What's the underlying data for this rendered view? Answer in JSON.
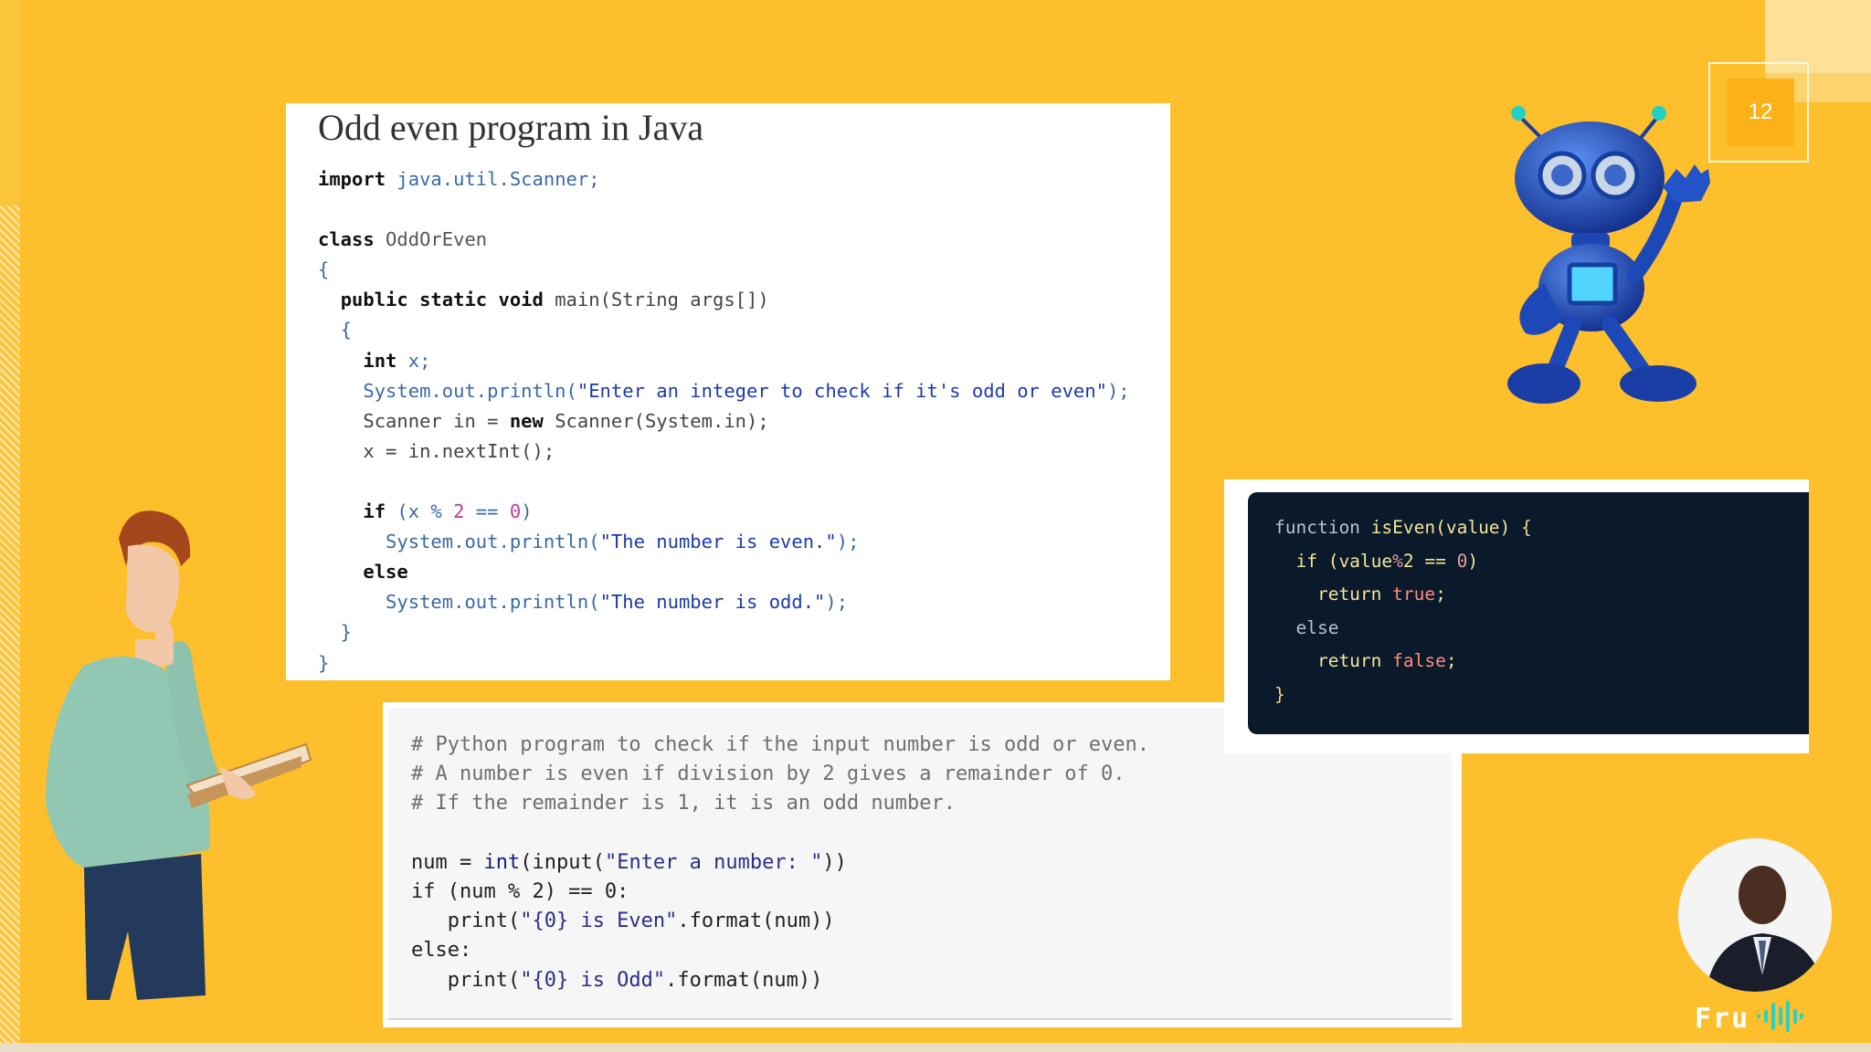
{
  "slide": {
    "page_number": "12"
  },
  "java": {
    "title": "Odd even program in Java",
    "lines": {
      "l1_kw": "import",
      "l1_rest": " java.util.Scanner;",
      "l3_kw": "class",
      "l3_rest": " OddOrEven",
      "l4": "{",
      "l5_indent": "  ",
      "l5_kw": "public static void",
      "l5_rest": " main(String args[])",
      "l6": "  {",
      "l7_indent": "    ",
      "l7_kw": "int",
      "l7_rest": " x;",
      "l8_pre": "    System.out.println(",
      "l8_str": "\"Enter an integer to check if it's odd or even\"",
      "l8_post": ");",
      "l9_pre": "    Scanner in = ",
      "l9_kw": "new",
      "l9_rest": " Scanner(System.in);",
      "l10": "    x = in.nextInt();",
      "l12_indent": "    ",
      "l12_kw": "if",
      "l12_a": " (x % ",
      "l12_n1": "2",
      "l12_b": " == ",
      "l12_n2": "0",
      "l12_c": ")",
      "l13_pre": "      System.out.println(",
      "l13_str": "\"The number is even.\"",
      "l13_post": ");",
      "l14_indent": "    ",
      "l14_kw": "else",
      "l15_pre": "      System.out.println(",
      "l15_str": "\"The number is odd.\"",
      "l15_post": ");",
      "l16": "  }",
      "l17": "}"
    }
  },
  "python": {
    "c1": "# Python program to check if the input number is odd or even.",
    "c2": "# A number is even if division by 2 gives a remainder of 0.",
    "c3": "# If the remainder is 1, it is an odd number.",
    "l5_a": "num = ",
    "l5_fn": "int",
    "l5_b": "(input(",
    "l5_str": "\"Enter a number: \"",
    "l5_c": "))",
    "l6": "if (num % 2) == 0:",
    "l7_a": "   print(",
    "l7_str": "\"{0} is Even\"",
    "l7_b": ".format(num))",
    "l8": "else:",
    "l9_a": "   print(",
    "l9_str": "\"{0} is Odd\"",
    "l9_b": ".format(num))"
  },
  "js": {
    "l1_kw": "function",
    "l1_fn": " isEven",
    "l1_rest": "(value) ",
    "l1_brace": "{",
    "l2_a": "  if (value",
    "l2_pct": "%",
    "l2_b": "2 == ",
    "l2_n": "0",
    "l2_c": ")",
    "l3_a": "    return ",
    "l3_lit": "true",
    "l3_b": ";",
    "l4": "  else",
    "l5_a": "    return ",
    "l5_lit": "false",
    "l5_b": ";",
    "l6": "}"
  },
  "brand": {
    "name": "Fru"
  },
  "colors": {
    "background": "#fdbf2b",
    "page_badge": "#fbb117",
    "js_panel": "#0b1a2b"
  }
}
